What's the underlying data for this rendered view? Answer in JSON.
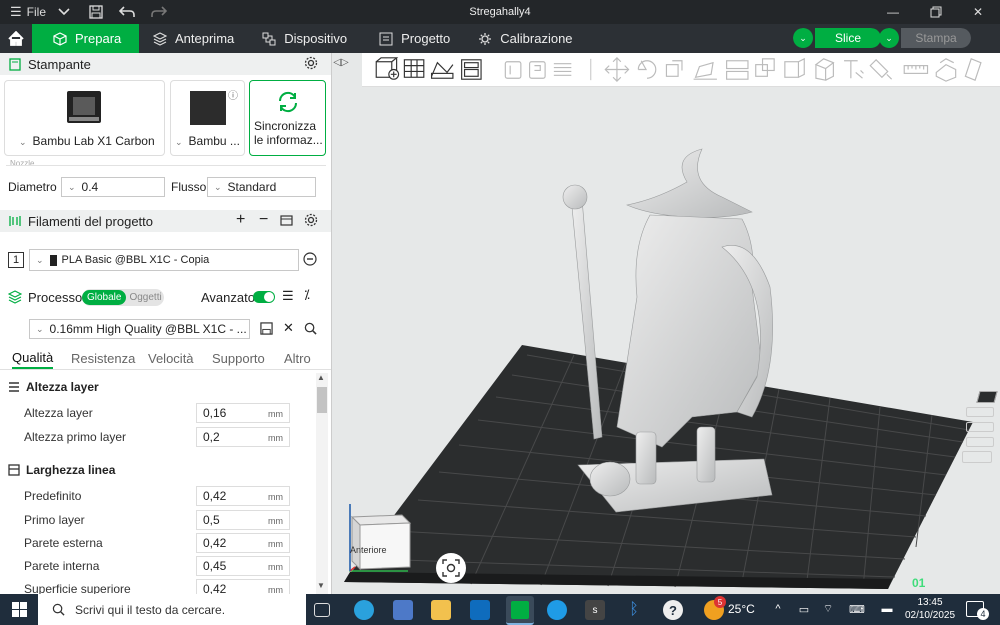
{
  "window": {
    "menu_label": "File",
    "title": "Stregahally4"
  },
  "nav": {
    "tabs": [
      {
        "label": "Prepara"
      },
      {
        "label": "Anteprima"
      },
      {
        "label": "Dispositivo"
      },
      {
        "label": "Progetto"
      },
      {
        "label": "Calibrazione"
      }
    ],
    "slice_label": "Slice",
    "print_label": "Stampa"
  },
  "printer": {
    "section_title": "Stampante",
    "printer_name": "Bambu Lab X1 Carbon",
    "plate_name": "Bambu ...",
    "sync_line1": "Sincronizza",
    "sync_line2": "le informaz...",
    "nozzle_group": "Nozzle",
    "diameter_label": "Diametro",
    "diameter_value": "0.4",
    "flow_label": "Flusso",
    "flow_value": "Standard"
  },
  "filament": {
    "section_title": "Filamenti del progetto",
    "slot_number": "1",
    "name": "PLA Basic @BBL X1C - Copia"
  },
  "process": {
    "section_title": "Processo",
    "toggle_global": "Globale",
    "toggle_objects": "Oggetti",
    "advanced_label": "Avanzato",
    "preset": "0.16mm High Quality @BBL X1C - ...",
    "tabs": [
      "Qualità",
      "Resistenza",
      "Velocità",
      "Supporto",
      "Altro"
    ],
    "groups": [
      {
        "title": "Altezza layer",
        "rows": [
          {
            "label": "Altezza layer",
            "value": "0,16",
            "unit": "mm"
          },
          {
            "label": "Altezza primo layer",
            "value": "0,2",
            "unit": "mm"
          }
        ]
      },
      {
        "title": "Larghezza linea",
        "rows": [
          {
            "label": "Predefinito",
            "value": "0,42",
            "unit": "mm"
          },
          {
            "label": "Primo layer",
            "value": "0,5",
            "unit": "mm"
          },
          {
            "label": "Parete esterna",
            "value": "0,42",
            "unit": "mm"
          },
          {
            "label": "Parete interna",
            "value": "0,45",
            "unit": "mm"
          },
          {
            "label": "Superficie superiore",
            "value": "0,42",
            "unit": "mm"
          }
        ]
      }
    ]
  },
  "viewport": {
    "cube_front_label": "Anteriore",
    "plate_number": "01"
  },
  "taskbar": {
    "search_placeholder": "Scrivi qui il testo da cercare.",
    "weather": "25°C",
    "time": "13:45",
    "date": "02/10/2025",
    "notification_count": "4",
    "mail_badge": "5"
  },
  "colors": {
    "accent": "#00ae42",
    "titlebar": "#232629",
    "nav": "#2c3035",
    "viewport_bg": "#e6e8e8",
    "plate": "#2b2d2e",
    "model": "#d4d6d7",
    "taskbar": "#1f2d3c"
  }
}
